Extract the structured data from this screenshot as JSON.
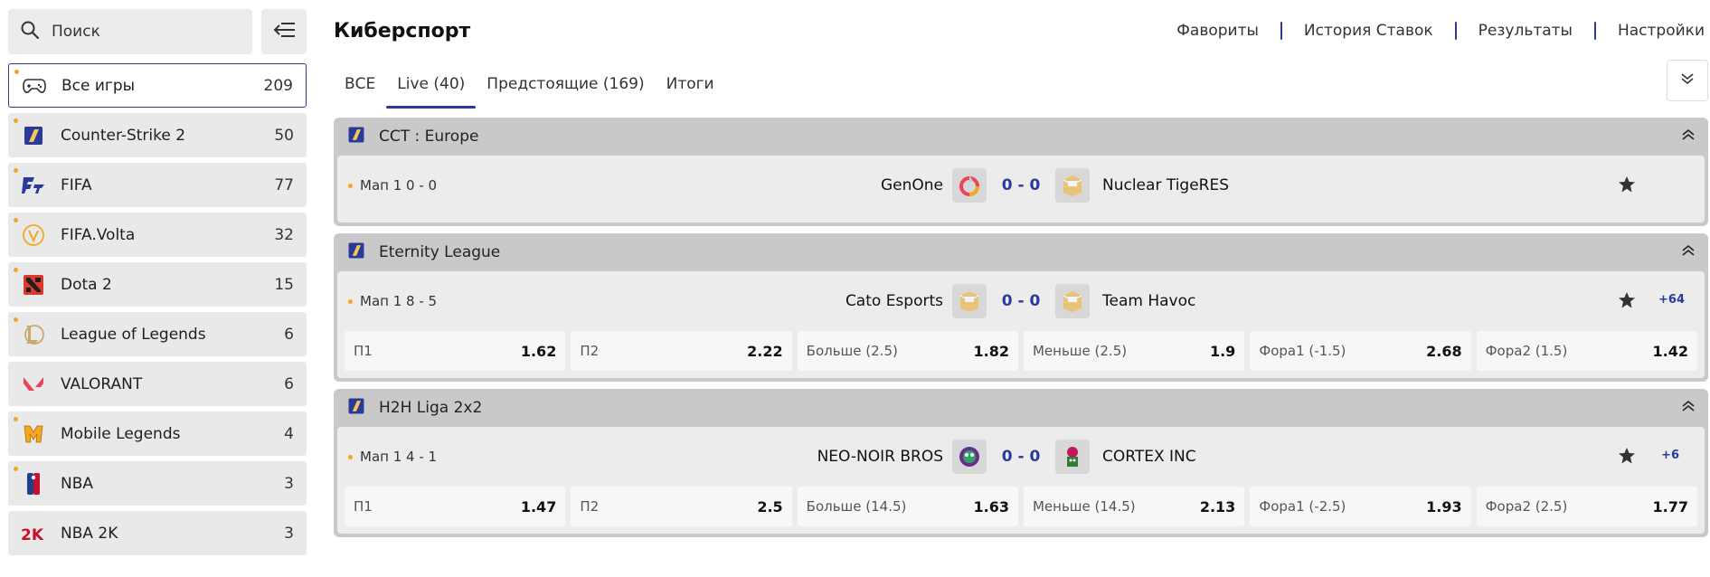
{
  "search": {
    "placeholder": "Поиск"
  },
  "games": [
    {
      "label": "Все игры",
      "count": "209",
      "icon": "gamepad-icon"
    },
    {
      "label": "Counter-Strike 2",
      "count": "50",
      "icon": "counter-strike-icon"
    },
    {
      "label": "FIFA",
      "count": "77",
      "icon": "fifa-icon"
    },
    {
      "label": "FIFA.Volta",
      "count": "32",
      "icon": "fifa-volta-icon"
    },
    {
      "label": "Dota 2",
      "count": "15",
      "icon": "dota-icon"
    },
    {
      "label": "League of Legends",
      "count": "6",
      "icon": "league-of-legends-icon"
    },
    {
      "label": "VALORANT",
      "count": "6",
      "icon": "valorant-icon"
    },
    {
      "label": "Mobile Legends",
      "count": "4",
      "icon": "mobile-legends-icon"
    },
    {
      "label": "NBA",
      "count": "3",
      "icon": "nba-icon"
    },
    {
      "label": "NBA 2K",
      "count": "3",
      "icon": "nba-2k-icon"
    }
  ],
  "header": {
    "title": "Киберспорт",
    "nav": [
      "Фавориты",
      "История Ставок",
      "Результаты",
      "Настройки"
    ]
  },
  "tabs": [
    "ВСЕ",
    "Live (40)",
    "Предстоящие (169)",
    "Итоги"
  ],
  "tournaments": [
    {
      "name": "CCT : Europe",
      "match": {
        "map": "Мап 1",
        "map_score": "0 - 0",
        "team1": "GenOne",
        "score": "0 - 0",
        "team2": "Nuclear TigeRES"
      }
    },
    {
      "name": "Eternity League",
      "match": {
        "map": "Мап 1",
        "map_score": "8 - 5",
        "team1": "Cato Esports",
        "score": "0 - 0",
        "team2": "Team Havoc",
        "more": "+64",
        "odds": [
          {
            "label": "П1",
            "value": "1.62"
          },
          {
            "label": "П2",
            "value": "2.22"
          },
          {
            "label": "Больше (2.5)",
            "value": "1.82"
          },
          {
            "label": "Меньше (2.5)",
            "value": "1.9"
          },
          {
            "label": "Фора1 (-1.5)",
            "value": "2.68"
          },
          {
            "label": "Фора2 (1.5)",
            "value": "1.42"
          }
        ]
      }
    },
    {
      "name": "H2H Liga 2x2",
      "match": {
        "map": "Мап 1",
        "map_score": "4 - 1",
        "team1": "NEO-NOIR BROS",
        "score": "0 - 0",
        "team2": "CORTEX INC",
        "more": "+6",
        "odds": [
          {
            "label": "П1",
            "value": "1.47"
          },
          {
            "label": "П2",
            "value": "2.5"
          },
          {
            "label": "Больше (14.5)",
            "value": "1.63"
          },
          {
            "label": "Меньше (14.5)",
            "value": "2.13"
          },
          {
            "label": "Фора1 (-2.5)",
            "value": "1.93"
          },
          {
            "label": "Фора2 (2.5)",
            "value": "1.77"
          }
        ]
      }
    }
  ],
  "colors": {
    "accent": "#2a3a9a",
    "highlight_dot": "#f2a623",
    "tournament_bg": "#c9c9c9"
  }
}
